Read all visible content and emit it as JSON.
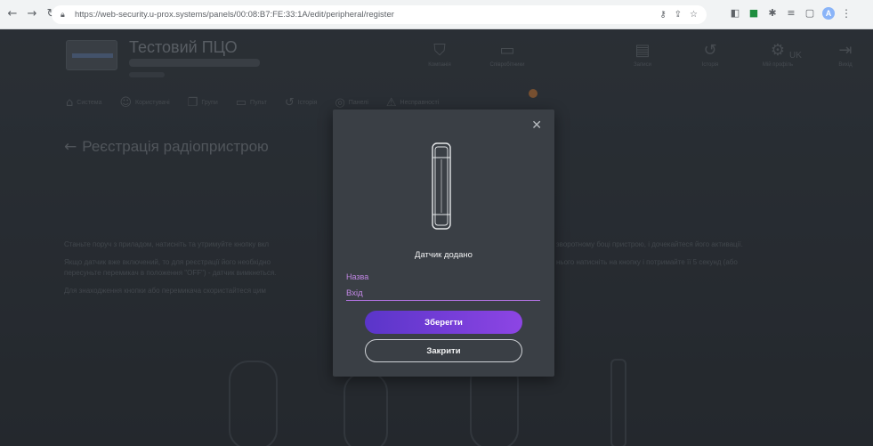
{
  "browser": {
    "url": "https://web-security.u-prox.systems/panels/00:08:B7:FE:33:1A/edit/peripheral/register",
    "nav_icons": [
      "back-icon",
      "forward-icon",
      "reload-icon"
    ],
    "extension_icons": [
      "key-icon",
      "share-icon",
      "star-icon",
      "extension-icon",
      "green-extension-icon",
      "puzzle-icon",
      "playlist-icon",
      "sidepanel-icon"
    ],
    "profile_initial": "A"
  },
  "app": {
    "brand_title": "Тестовий ПЦО",
    "top_nav": [
      {
        "label": "Компанія",
        "icon": "shield-icon"
      },
      {
        "label": "Співробітники",
        "icon": "id-card-icon"
      },
      {
        "label": "",
        "icon": "blank"
      },
      {
        "label": "Записи",
        "icon": "clipboard-icon"
      },
      {
        "label": "Історія",
        "icon": "history-icon"
      },
      {
        "label": "Мій профіль",
        "icon": "user-gear-icon"
      },
      {
        "label": "Вихід",
        "icon": "logout-icon"
      }
    ],
    "language": "UK",
    "sub_nav": [
      {
        "label": "Система",
        "icon": "home-icon"
      },
      {
        "label": "Користувачі",
        "icon": "user-icon"
      },
      {
        "label": "Групи",
        "icon": "groups-icon"
      },
      {
        "label": "Пульт",
        "icon": "monitor-icon"
      },
      {
        "label": "Історія",
        "icon": "history-icon"
      },
      {
        "label": "Панелі",
        "icon": "panel-icon"
      },
      {
        "label": "Несправності",
        "icon": "warning-icon"
      }
    ],
    "page_title": "Реєстрація радіопристрою",
    "instructions_left": [
      "Станьте поруч з приладом, натисніть та утримуйте кнопку вкл",
      "Якщо датчик вже включений, то для реєстрації його необхідно",
      "пересуньте перемикач в положення \"OFF\") - датчик вимкнеться.",
      "Для знаходження кнопки або перемикача скористайтеся цим"
    ],
    "instructions_right": [
      "зворотному боці пристрою, і дочекайтеся його активації.",
      "нього натисніть на кнопку і потримайте її 5 секунд (або",
      ""
    ]
  },
  "modal": {
    "title": "Датчик додано",
    "field_label": "Назва",
    "field_value": "Вхід",
    "save_label": "Зберегти",
    "close_label": "Закрити",
    "accent": "#8d45e4"
  }
}
